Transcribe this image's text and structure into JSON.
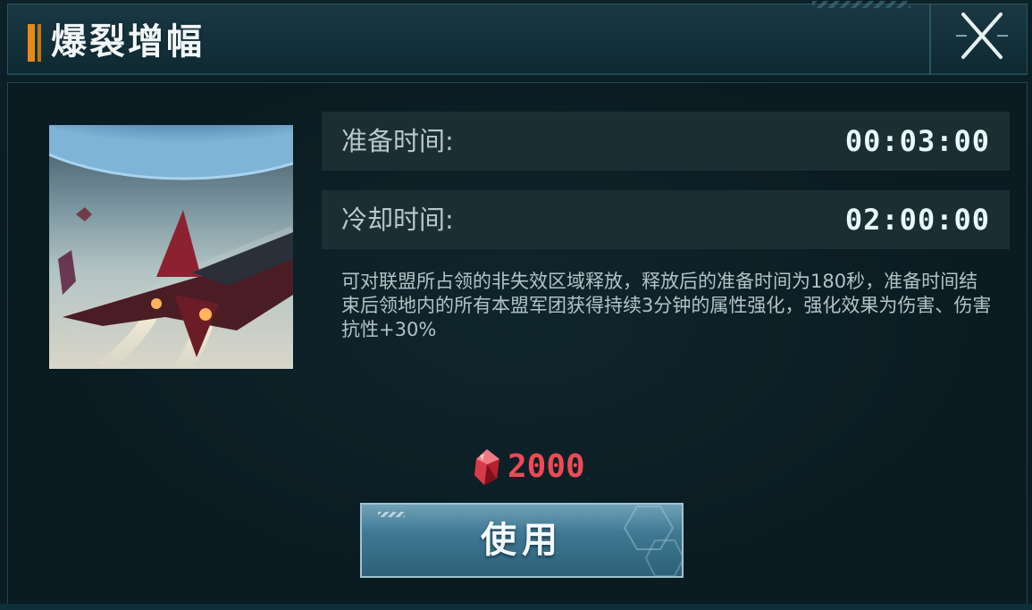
{
  "dialog": {
    "title": "爆裂增幅",
    "close_icon": "close-x-icon"
  },
  "skill": {
    "image_icon": "spaceship-battle-illustration",
    "prep_label": "准备时间:",
    "prep_value": "00:03:00",
    "cooldown_label": "冷却时间:",
    "cooldown_value": "02:00:00",
    "description": "可对联盟所占领的非失效区域释放，释放后的准备时间为180秒，准备时间结束后领地内的所有本盟军团获得持续3分钟的属性强化，强化效果为伤害、伤害抗性+30%"
  },
  "cost": {
    "icon": "red-crystal-gem-icon",
    "value": "2000",
    "color": "#ef4a55"
  },
  "actions": {
    "use_label": "使用"
  },
  "colors": {
    "accent": "#e58a1a",
    "panel": "#1a2e34",
    "button": "#3f7892"
  }
}
